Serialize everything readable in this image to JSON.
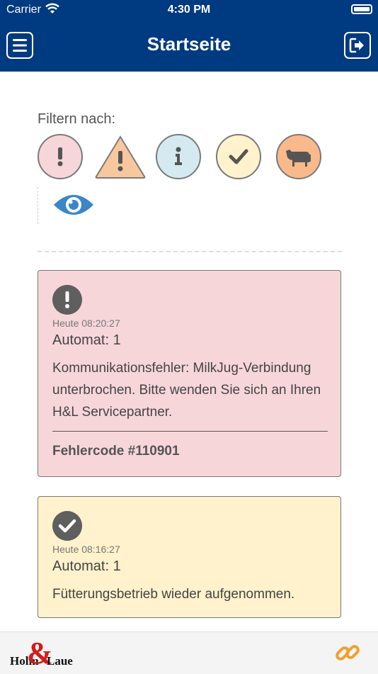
{
  "status_bar": {
    "carrier": "Carrier",
    "time": "4:30 PM"
  },
  "nav": {
    "title": "Startseite",
    "menu_icon": "hamburger-menu-icon",
    "logout_icon": "sign-out-icon"
  },
  "filter": {
    "label": "Filtern nach:",
    "options": [
      {
        "icon": "alert-circle-icon",
        "color": "#f7d6da"
      },
      {
        "icon": "warning-triangle-icon",
        "color": "#f9c79e"
      },
      {
        "icon": "info-icon",
        "color": "#d4eaf0"
      },
      {
        "icon": "check-icon",
        "color": "#fff2cc"
      },
      {
        "icon": "cow-icon",
        "color": "#f9b98a"
      },
      {
        "icon": "eye-icon",
        "color": "#3a86c8"
      }
    ]
  },
  "notifications": [
    {
      "type": "error",
      "icon": "alert-circle-icon",
      "time": "Heute 08:20:27",
      "automat": "Automat: 1",
      "message": "Kommunikationsfehler: MilkJug-Verbindung unterbrochen. Bitte wenden Sie sich an Ihren H&L Servicepartner.",
      "code": "Fehlercode #110901",
      "background": "#f7d6da"
    },
    {
      "type": "ok",
      "icon": "check-circle-icon",
      "time": "Heute 08:16:27",
      "automat": "Automat: 1",
      "message": "Fütterungsbetrieb wieder aufgenommen.",
      "background": "#fff2cc"
    }
  ],
  "footer": {
    "logo_left": "Holm",
    "logo_amp": "&",
    "logo_right": "Laue",
    "link_icon": "link-icon",
    "link_color": "#f0a030"
  }
}
